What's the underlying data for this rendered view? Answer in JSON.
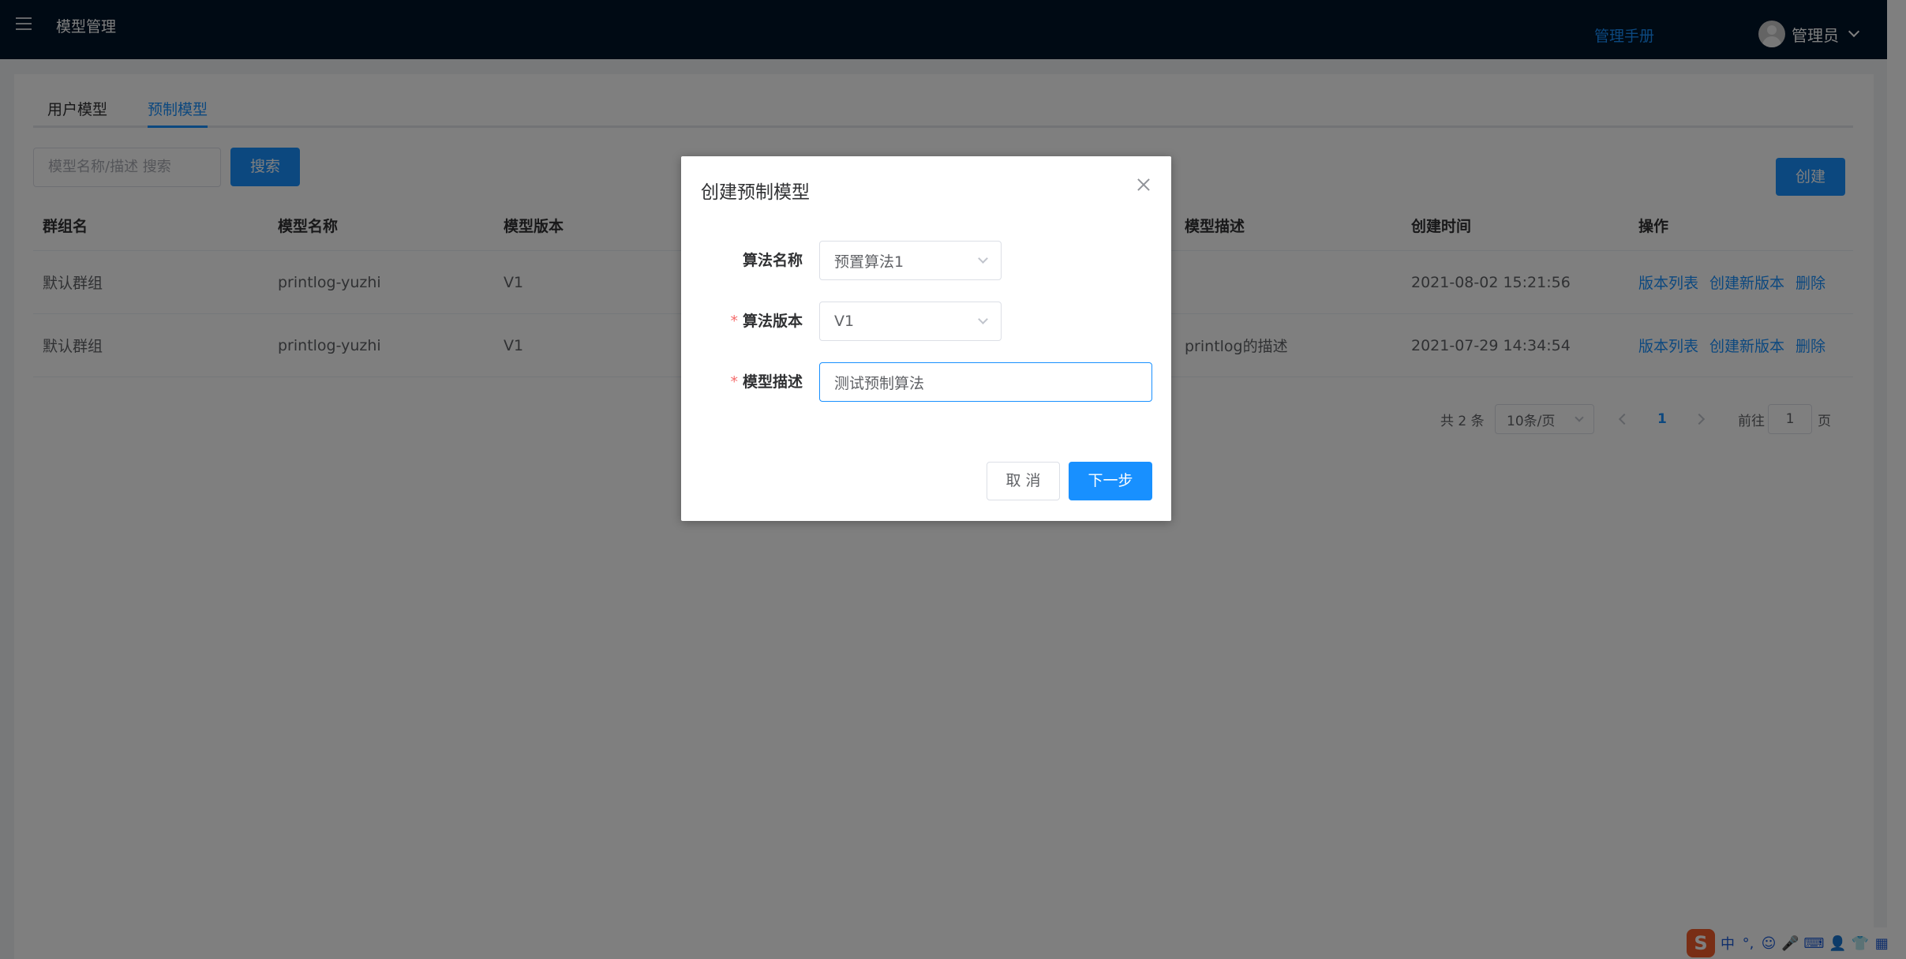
{
  "header": {
    "app_title": "模型管理",
    "manual_label": "管理手册",
    "user_name": "管理员"
  },
  "tabs": [
    "用户模型",
    "预制模型"
  ],
  "active_tab": 1,
  "search": {
    "placeholder": "模型名称/描述 搜索",
    "button_label": "搜索"
  },
  "create_label": "创建",
  "table": {
    "columns": [
      "群组名",
      "模型名称",
      "模型版本",
      "模型描述",
      "创建时间",
      "操作"
    ],
    "rows": [
      {
        "group": "默认群组",
        "name": "printlog-yuzhi",
        "version": "V1",
        "description": "",
        "created": "2021-08-02 15:21:56"
      },
      {
        "group": "默认群组",
        "name": "printlog-yuzhi",
        "version": "V1",
        "description": "printlog的描述",
        "created": "2021-07-29 14:34:54"
      }
    ],
    "ops": [
      "版本列表",
      "创建新版本",
      "删除"
    ]
  },
  "pagination": {
    "total": "共 2 条",
    "page_size": "10条/页",
    "current_page": "1",
    "goto_prefix": "前往",
    "goto_value": "1",
    "goto_suffix": "页"
  },
  "dialog": {
    "title": "创建预制模型",
    "fields": {
      "algorithm_name": {
        "label": "算法名称",
        "value": "预置算法1",
        "required": false
      },
      "algorithm_version": {
        "label": "算法版本",
        "value": "V1",
        "required": true
      },
      "model_description": {
        "label": "模型描述",
        "value": "测试预制算法",
        "required": true
      }
    },
    "cancel_label": "取 消",
    "next_label": "下一步"
  },
  "ime": {
    "logo": "S",
    "items": [
      "中",
      "°,",
      "☺",
      "🎤",
      "⌨",
      "👤",
      "👕",
      "▦"
    ]
  },
  "colors": {
    "primary": "#1890ff",
    "topbar": "#001529",
    "required": "#f56c6c"
  }
}
